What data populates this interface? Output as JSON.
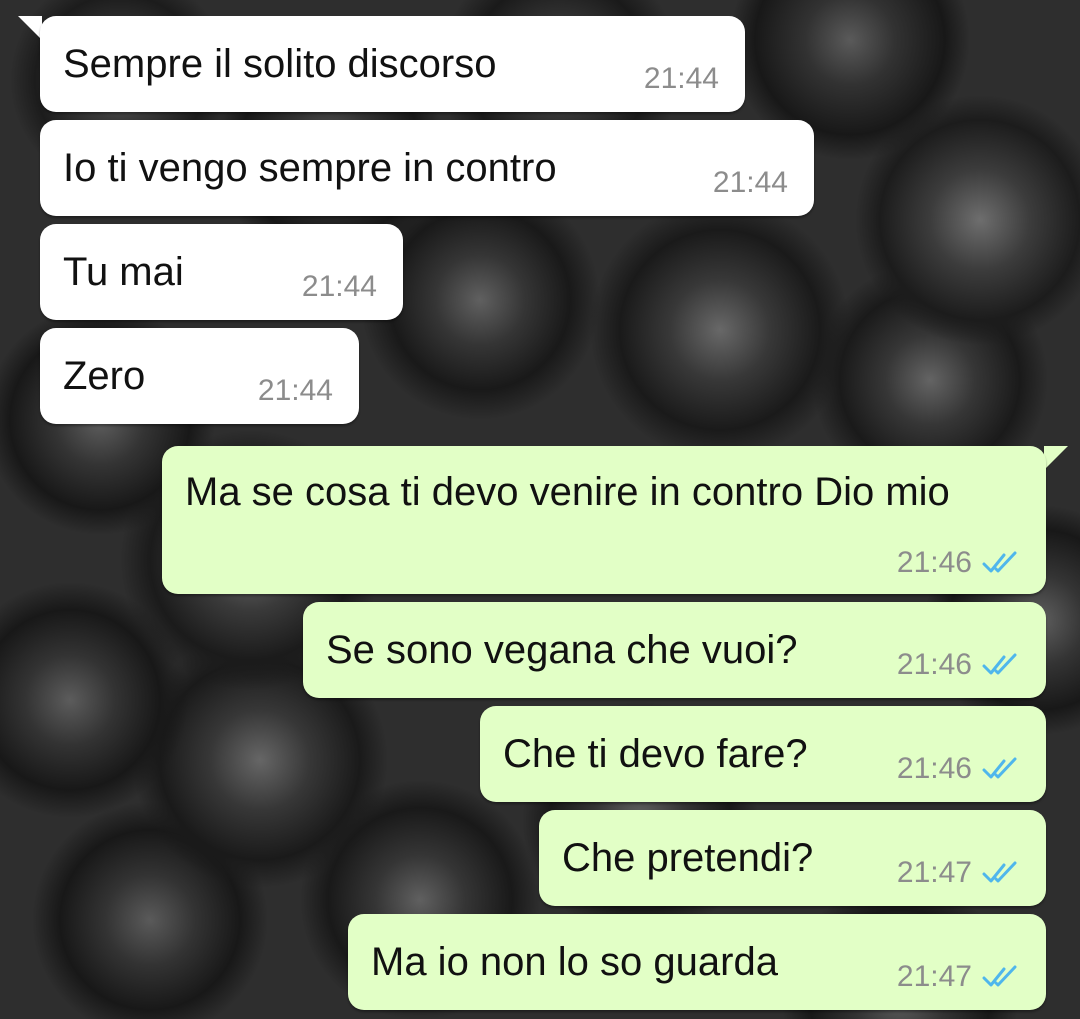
{
  "messages": [
    {
      "direction": "in",
      "text": "Sempre il solito discorso",
      "time": "21:44"
    },
    {
      "direction": "in",
      "text": "Io ti vengo sempre in contro",
      "time": "21:44"
    },
    {
      "direction": "in",
      "text": "Tu mai",
      "time": "21:44"
    },
    {
      "direction": "in",
      "text": "Zero",
      "time": "21:44"
    },
    {
      "direction": "out",
      "text": "Ma se cosa ti devo venire in contro Dio mio",
      "time": "21:46",
      "status": "read"
    },
    {
      "direction": "out",
      "text": "Se sono vegana che vuoi?",
      "time": "21:46",
      "status": "read"
    },
    {
      "direction": "out",
      "text": "Che ti devo fare?",
      "time": "21:46",
      "status": "read"
    },
    {
      "direction": "out",
      "text": "Che pretendi?",
      "time": "21:47",
      "status": "read"
    },
    {
      "direction": "out",
      "text": "Ma io non lo so guarda",
      "time": "21:47",
      "status": "read"
    }
  ],
  "colors": {
    "incoming_bubble": "#ffffff",
    "outgoing_bubble": "#e2ffc6",
    "timestamp": "#8c8c8c",
    "read_ticks": "#4fb6ec",
    "background": "#2e2e2e"
  },
  "icons": {
    "read_receipt": "double-check-icon",
    "wallpaper": "black-roses-wallpaper"
  }
}
